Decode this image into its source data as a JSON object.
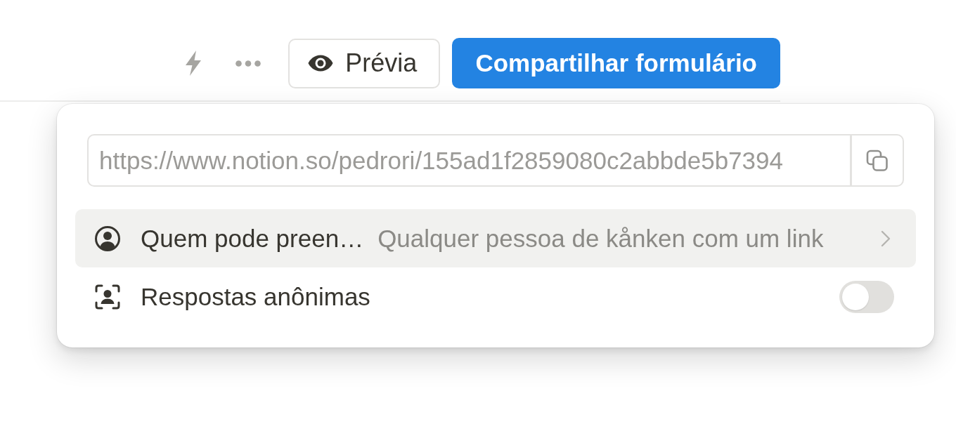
{
  "toolbar": {
    "preview_button": {
      "label": "Prévia"
    },
    "share_button": {
      "label": "Compartilhar formulário"
    }
  },
  "share_popover": {
    "link_field": {
      "value": "https://www.notion.so/pedrori/155ad1f2859080c2abbde5b7394"
    },
    "settings": [
      {
        "kind": "link",
        "label": "Quem pode preen…",
        "value": "Qualquer pessoa de kånken com um link",
        "highlighted": true
      },
      {
        "kind": "toggle",
        "label": "Respostas anônimas",
        "on": false,
        "highlighted": false
      }
    ]
  }
}
